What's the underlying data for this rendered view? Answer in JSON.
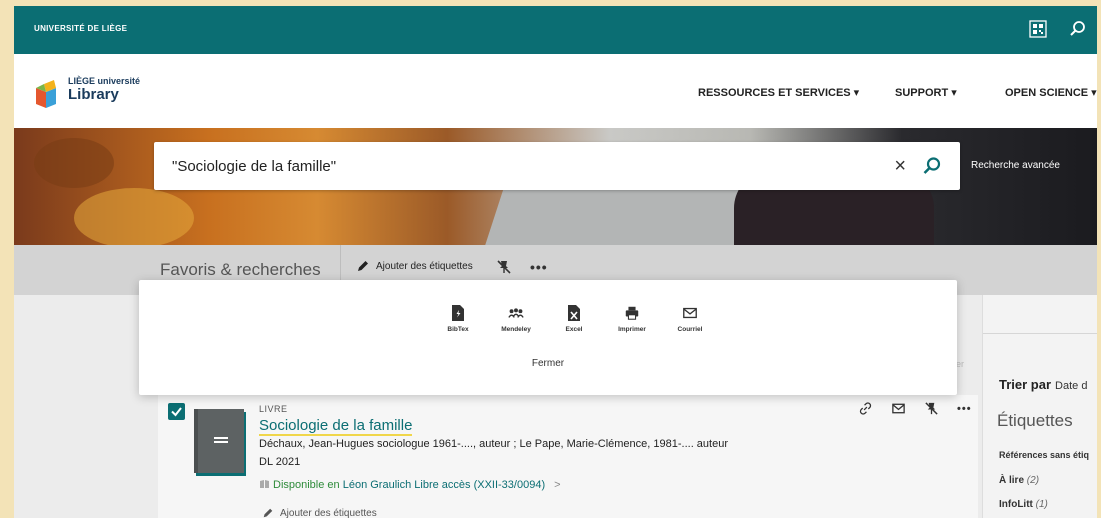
{
  "header": {
    "university": "UNIVERSITÉ DE LIÈGE",
    "logo_line1": "LIÈGE université",
    "logo_line2": "Library",
    "nav": [
      "RESSOURCES ET SERVICES ▾",
      "SUPPORT ▾",
      "OPEN SCIENCE ▾"
    ]
  },
  "search": {
    "query": "\"Sociologie de la famille\"",
    "clear": "×",
    "advanced": "Recherche avancée"
  },
  "toolbar": {
    "title": "Favoris & recherches",
    "add_tags": "Ajouter des étiquettes",
    "more": "•••"
  },
  "popup": {
    "exports": [
      "BibTex",
      "Mendeley",
      "Excel",
      "Imprimer",
      "Courriel"
    ],
    "close": "Fermer"
  },
  "result": {
    "type": "LIVRE",
    "title": "Sociologie de la famille",
    "authors": "Déchaux, Jean-Hugues sociologue 1961-...., auteur ; Le Pape, Marie-Clémence, 1981-.... auteur",
    "date": "DL 2021",
    "availability": "Disponible en",
    "location": "Léon Graulich  Libre accès (XXII-33/0094)",
    "chevron": ">",
    "add_tags": "Ajouter des étiquettes",
    "selected": true
  },
  "sidebar": {
    "hint": "ier",
    "sort_label": "Trier par",
    "sort_value": "Date d",
    "tags_title": "Étiquettes",
    "tags": [
      {
        "label": "Références sans étiq",
        "count": ""
      },
      {
        "label": "À lire",
        "count": "(2)"
      },
      {
        "label": "InfoLitt",
        "count": "(1)"
      }
    ]
  },
  "colors": {
    "teal": "#0b6e73",
    "available_green": "#2e8b3a",
    "highlight_yellow": "#f0d64a"
  }
}
